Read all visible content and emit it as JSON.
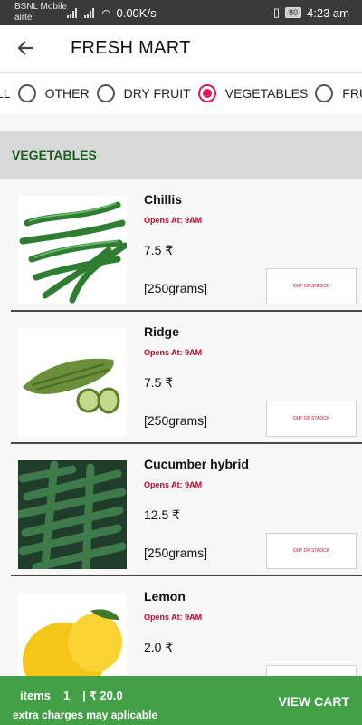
{
  "status": {
    "carrier1": "BSNL Mobile",
    "carrier2": "airtel",
    "speed": "0.00K/s",
    "battery": "80",
    "time": "4:23 am"
  },
  "appbar": {
    "title": "FRESH MART"
  },
  "filters": [
    {
      "label": "LL",
      "selected": false
    },
    {
      "label": "OTHER",
      "selected": false
    },
    {
      "label": "DRY FRUIT",
      "selected": false
    },
    {
      "label": "VEGETABLES",
      "selected": true
    },
    {
      "label": "FRUITS",
      "selected": false
    }
  ],
  "section": {
    "title": "VEGETABLES"
  },
  "opens_label": "Opens At:  9AM",
  "products": [
    {
      "name": "Chillis",
      "price": "7.5 ₹",
      "qty": "[250grams]",
      "status": "OUT OF STAOCK"
    },
    {
      "name": "Ridge",
      "price": "7.5 ₹",
      "qty": "[250grams]",
      "status": "OUT OF STAOCK"
    },
    {
      "name": "Cucumber hybrid",
      "price": "12.5 ₹",
      "qty": "[250grams]",
      "status": "OUT OF STAOCK"
    },
    {
      "name": "Lemon",
      "price": "2.0 ₹",
      "qty": "",
      "status": ""
    }
  ],
  "cart": {
    "items_label": "items",
    "items_count": "1",
    "total": "| ₹ 20.0",
    "note": "extra charges may aplicable",
    "button": "VIEW CART"
  },
  "colors": {
    "accent": "#d81b60",
    "cart_bar": "#43a047",
    "section_text": "#1b5e20"
  }
}
